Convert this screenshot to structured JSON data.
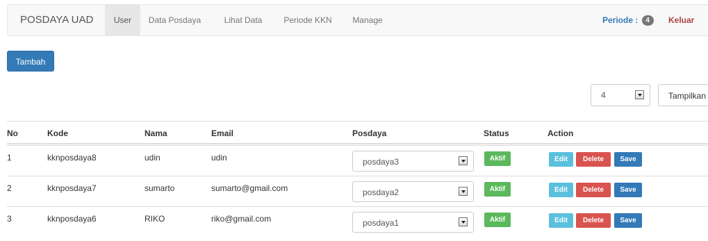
{
  "navbar": {
    "brand": "POSDAYA UAD",
    "items": [
      {
        "label": "User",
        "active": true
      },
      {
        "label": "Data Posdaya",
        "active": false
      },
      {
        "label": "Lihat Data",
        "active": false
      },
      {
        "label": "Periode KKN",
        "active": false
      },
      {
        "label": "Manage",
        "active": false
      }
    ],
    "periode_label": "Periode :",
    "periode_badge": "4",
    "keluar": "Keluar"
  },
  "toolbar": {
    "tambah_label": "Tambah",
    "periode_select_value": "4",
    "tampilkan_label": "Tampilkan"
  },
  "table": {
    "headers": [
      "No",
      "Kode",
      "Nama",
      "Email",
      "Posdaya",
      "Status",
      "Action"
    ],
    "rows": [
      {
        "no": "1",
        "kode": "kknposdaya8",
        "nama": "udin",
        "email": "udin",
        "posdaya": "posdaya3",
        "status": "Aktif"
      },
      {
        "no": "2",
        "kode": "kknposdaya7",
        "nama": "sumarto",
        "email": "sumarto@gmail.com",
        "posdaya": "posdaya2",
        "status": "Aktif"
      },
      {
        "no": "3",
        "kode": "kknposdaya6",
        "nama": "RIKO",
        "email": "riko@gmail.com",
        "posdaya": "posdaya1",
        "status": "Aktif"
      }
    ],
    "actions": {
      "edit": "Edit",
      "delete": "Delete",
      "save": "Save"
    }
  },
  "colors": {
    "primary": "#337ab7",
    "success": "#5cb85c",
    "info": "#5bc0de",
    "danger": "#d9534f",
    "logout": "#a94442"
  },
  "icons": {
    "select_arrow": "chevron-down-icon"
  }
}
